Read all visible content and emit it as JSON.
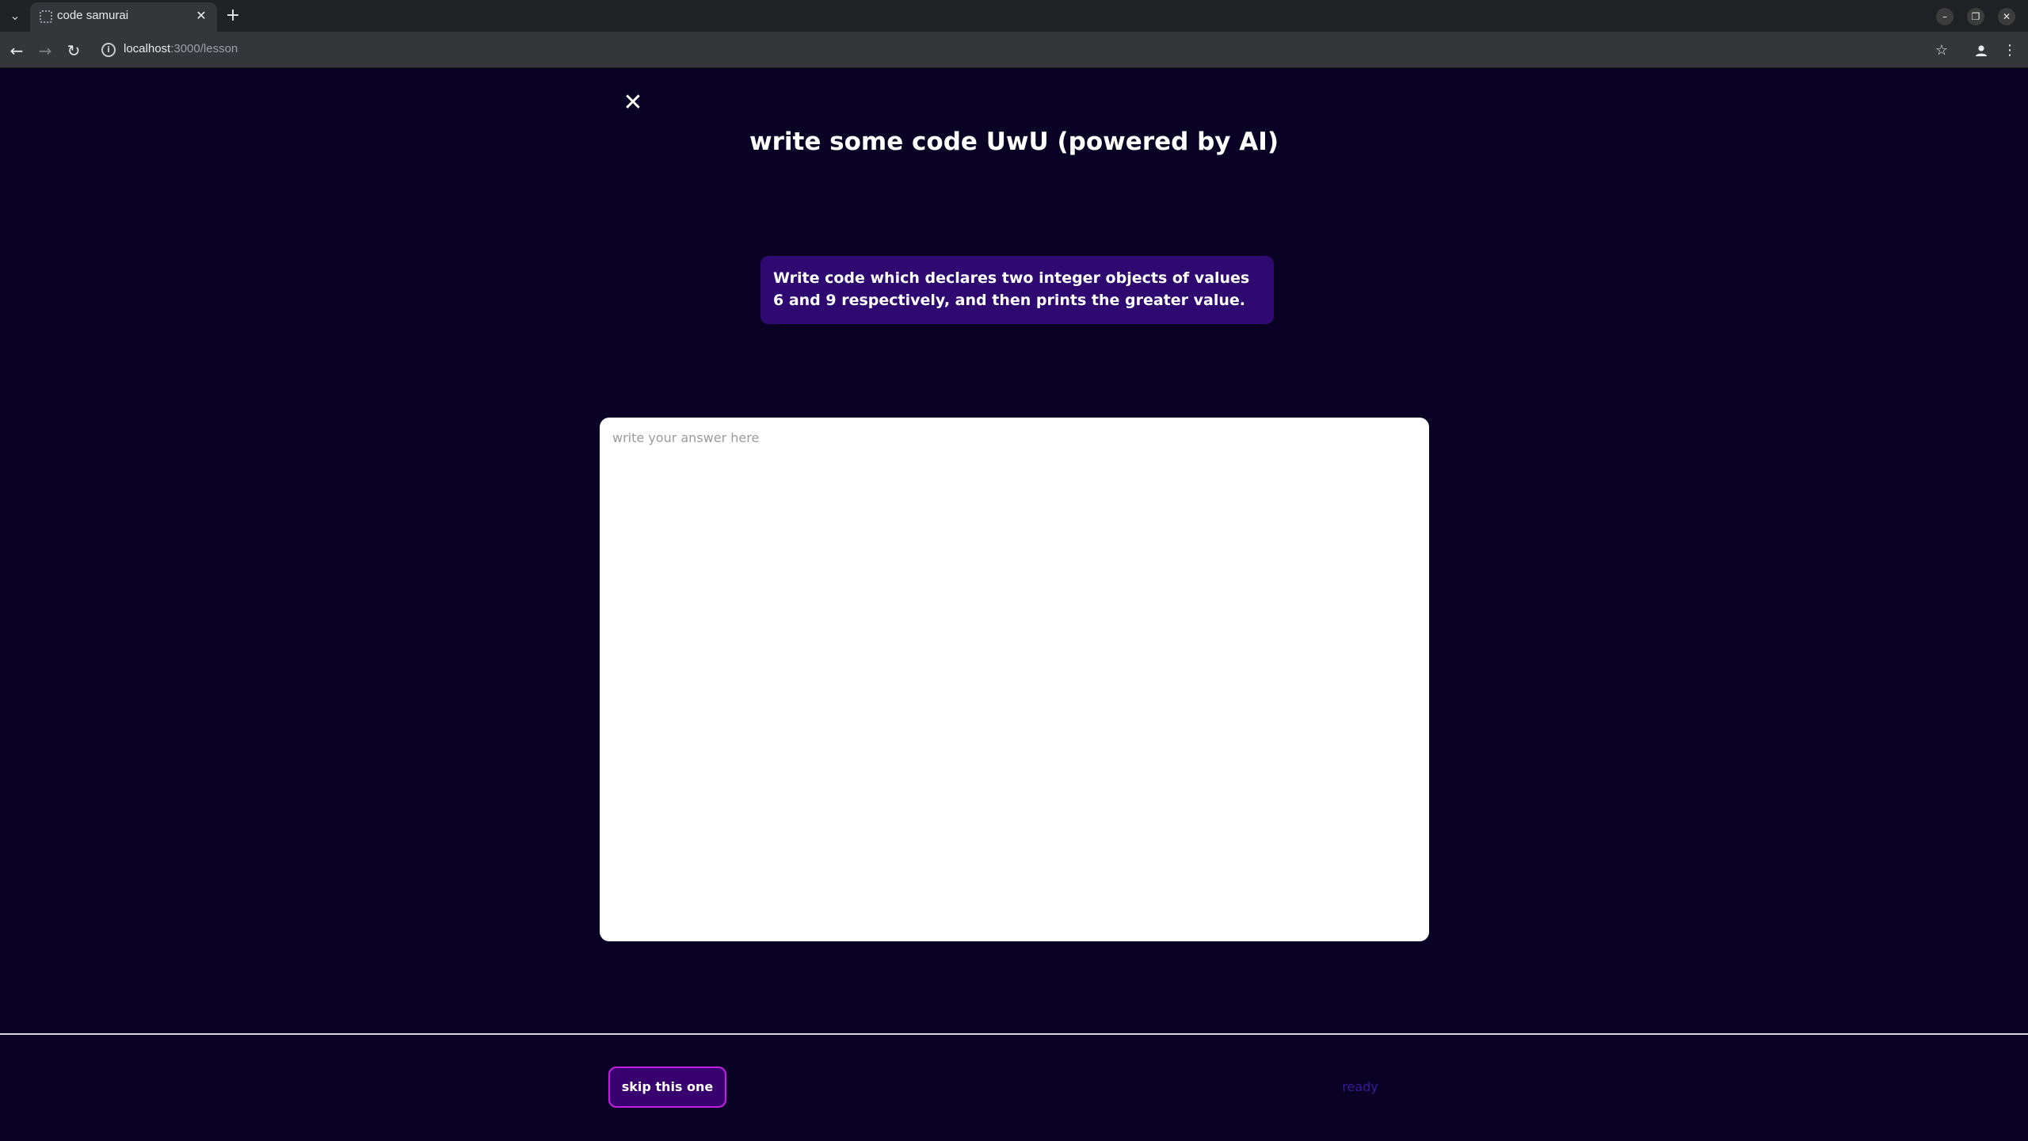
{
  "browser": {
    "tab_title": "code samurai",
    "url_host": "localhost",
    "url_path": ":3000/lesson",
    "icons": [
      "tab-search-icon",
      "favicon-icon",
      "tab-close-icon",
      "new-tab-icon",
      "back-icon",
      "forward-icon",
      "reload-icon",
      "site-info-icon",
      "bookmark-star-icon",
      "profile-icon",
      "menu-icon",
      "minimize-icon",
      "restore-icon",
      "window-close-icon"
    ]
  },
  "lesson": {
    "close_icon": "close-icon",
    "title": "write some code UwU (powered by AI)",
    "prompt": "Write code which declares two integer objects of values 6 and 9 respectively, and then prints the greater value.",
    "answer_placeholder": "write your answer here",
    "answer_value": ""
  },
  "footer": {
    "skip_label": "skip this one",
    "ready_label": "ready"
  },
  "colors": {
    "page_background": "#0a0224",
    "prompt_background": "#2e0a70",
    "skip_background": "#37006e",
    "skip_border": "#c41ee3",
    "ready_text": "#3a1a9a"
  }
}
